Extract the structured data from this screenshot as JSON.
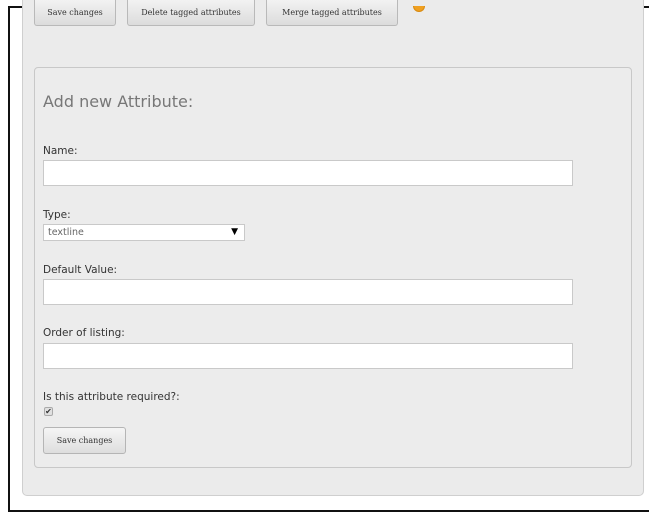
{
  "toolbar": {
    "save_label": "Save changes",
    "delete_tagged_label": "Delete tagged attributes",
    "merge_tagged_label": "Merge tagged attributes",
    "help_icon": "help-icon"
  },
  "form": {
    "title": "Add new Attribute:",
    "name_label": "Name:",
    "name_value": "",
    "type_label": "Type:",
    "type_selected": "textline",
    "type_arrow": "▼",
    "default_label": "Default Value:",
    "default_value": "",
    "order_label": "Order of listing:",
    "order_value": "",
    "required_label": "Is this attribute required?:",
    "required_checked": true,
    "required_check_glyph": "✔",
    "save_label": "Save changes"
  },
  "colors": {
    "container_bg": "#ebebeb",
    "help_icon": "#f0a020"
  }
}
